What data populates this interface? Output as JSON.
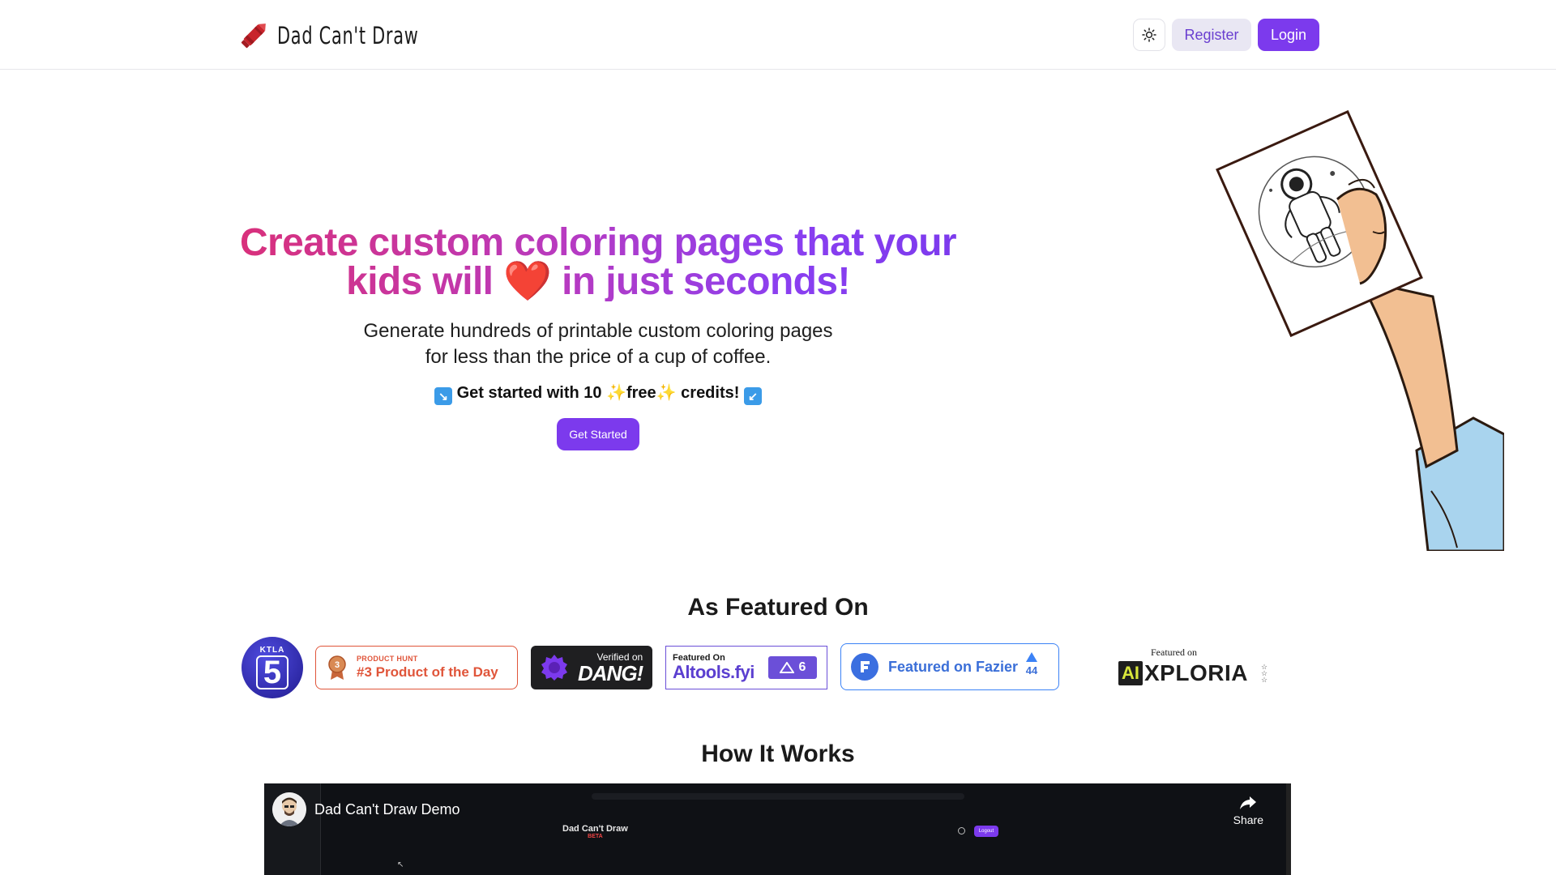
{
  "header": {
    "brand_name": "Dad Can't Draw",
    "logo_icon": "crayon-icon",
    "theme_toggle_icon": "sun-icon",
    "register_label": "Register",
    "login_label": "Login"
  },
  "hero": {
    "title_part1": "Create custom coloring pages that your kids will",
    "title_heart": "❤️",
    "title_part2": "in just seconds!",
    "subtitle_line1": "Generate hundreds of printable custom coloring pages",
    "subtitle_line2": "for less than the price of a cup of coffee.",
    "cta_arrow_left": "↘",
    "cta_part1": "Get started with 10",
    "cta_sparkle": "✨",
    "cta_free": "free",
    "cta_part2": "credits!",
    "cta_arrow_right": "↙",
    "get_started_label": "Get Started",
    "illustration_icon": "hand-holding-coloring-page-icon"
  },
  "featured": {
    "title": "As Featured On",
    "ktla": {
      "top": "KTLA",
      "num": "5"
    },
    "product_hunt": {
      "small": "PRODUCT HUNT",
      "big": "#3 Product of the Day",
      "medal_number": "3"
    },
    "dang": {
      "verified": "Verified on",
      "name": "DANG!"
    },
    "aitools": {
      "featured": "Featured On",
      "name": "Altools.fyi",
      "count": "6"
    },
    "fazier": {
      "text": "Featured on Fazier",
      "votes": "44"
    },
    "xploria": {
      "featured": "Featured on",
      "ai": "AI",
      "name": "XPLORIA"
    }
  },
  "how": {
    "title": "How It Works",
    "video_title": "Dad Can't Draw Demo",
    "share_label": "Share",
    "inner_brand": "Dad Can't Draw",
    "inner_beta": "BETA",
    "inner_logout": "Logout"
  },
  "colors": {
    "accent": "#7c3aed",
    "gradient_start": "#d9307a",
    "gradient_end": "#7c3aed"
  }
}
